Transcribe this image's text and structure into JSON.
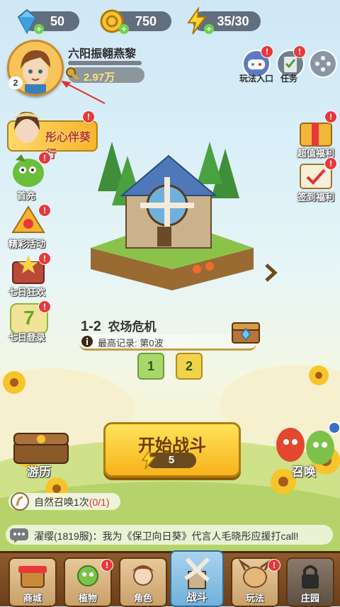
{
  "resources": {
    "diamond": "50",
    "coin": "750",
    "energy": "35/30"
  },
  "player": {
    "level": "2",
    "name": "六阳振翱燕黎",
    "gold": "2.97万"
  },
  "top_right": {
    "gameplay_label": "玩法入口",
    "task_label": "任务"
  },
  "left_menu": {
    "banner_text": "彤心伴葵行",
    "first_charge": "首充",
    "activities": "精彩活动",
    "seven_day_carnival": "七日狂欢",
    "seven_day_login": "七日登录",
    "seven_day_digit": "7",
    "travel": "游历"
  },
  "right_menu": {
    "value_welfare": "超值福利",
    "signin_welfare": "签到福利",
    "summon": "召唤"
  },
  "stage": {
    "number": "1-2",
    "name": "农场危机",
    "record": "最高记录: 第0波",
    "waves": [
      "1",
      "2"
    ]
  },
  "start": {
    "label": "开始战斗",
    "cost": "5"
  },
  "summon_task": {
    "text": "自然召唤1次",
    "progress": "(0/1)"
  },
  "chat": {
    "message": "濯缨(1819服)：我为《保卫向日葵》代言人毛晓彤应援打call!"
  },
  "nav": {
    "items": [
      "商城",
      "植物",
      "角色",
      "战斗",
      "玩法",
      "庄园"
    ]
  },
  "badge": "!",
  "colors": {
    "accent_yellow": "#f8b21a",
    "badge_red": "#e8383b",
    "nav_brown": "#8f5a2c"
  }
}
